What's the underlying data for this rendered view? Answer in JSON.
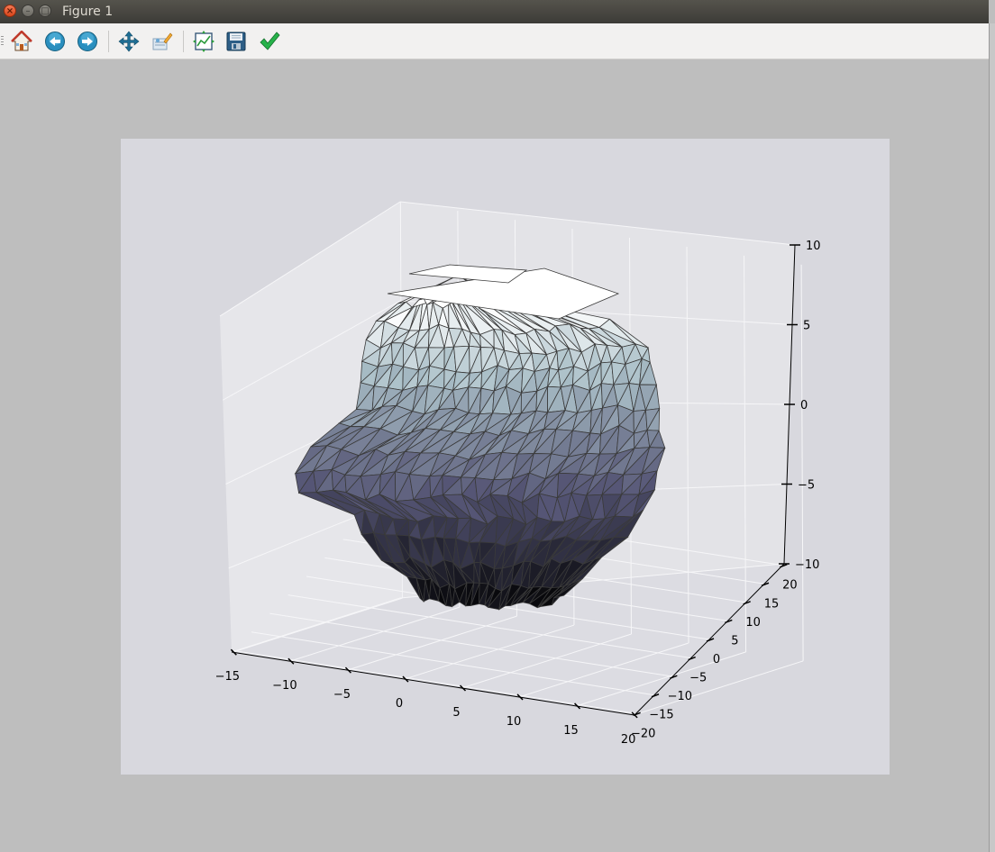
{
  "window": {
    "title": "Figure 1",
    "close_glyph": "×",
    "minimize_glyph": "–",
    "maximize_glyph": "□"
  },
  "toolbar": {
    "buttons": [
      {
        "name": "home",
        "icon": "home-icon"
      },
      {
        "name": "back",
        "icon": "back-arrow-icon"
      },
      {
        "name": "forward",
        "icon": "forward-arrow-icon"
      },
      {
        "name": "pan",
        "icon": "pan-move-icon"
      },
      {
        "name": "zoom",
        "icon": "zoom-rect-icon"
      },
      {
        "name": "subplots",
        "icon": "configure-subplots-icon"
      },
      {
        "name": "save",
        "icon": "floppy-save-icon"
      },
      {
        "name": "edit",
        "icon": "checkmark-edit-icon"
      }
    ]
  },
  "chart_data": {
    "type": "3d-trisurf",
    "title": "",
    "x_ticks": [
      "−15",
      "−10",
      "−5",
      "0",
      "5",
      "10",
      "15",
      "20"
    ],
    "y_ticks": [
      "−20",
      "−15",
      "−10",
      "−5",
      "0",
      "5",
      "10",
      "15",
      "20"
    ],
    "z_ticks": [
      "−10",
      "−5",
      "0",
      "5",
      "10"
    ],
    "xlim": [
      -15,
      20
    ],
    "ylim": [
      -20,
      20
    ],
    "zlim": [
      -10,
      10
    ],
    "colormap": "bone",
    "grid": true,
    "figure_bg": "#d8d8de",
    "pane_color": "#e4e4e8"
  }
}
